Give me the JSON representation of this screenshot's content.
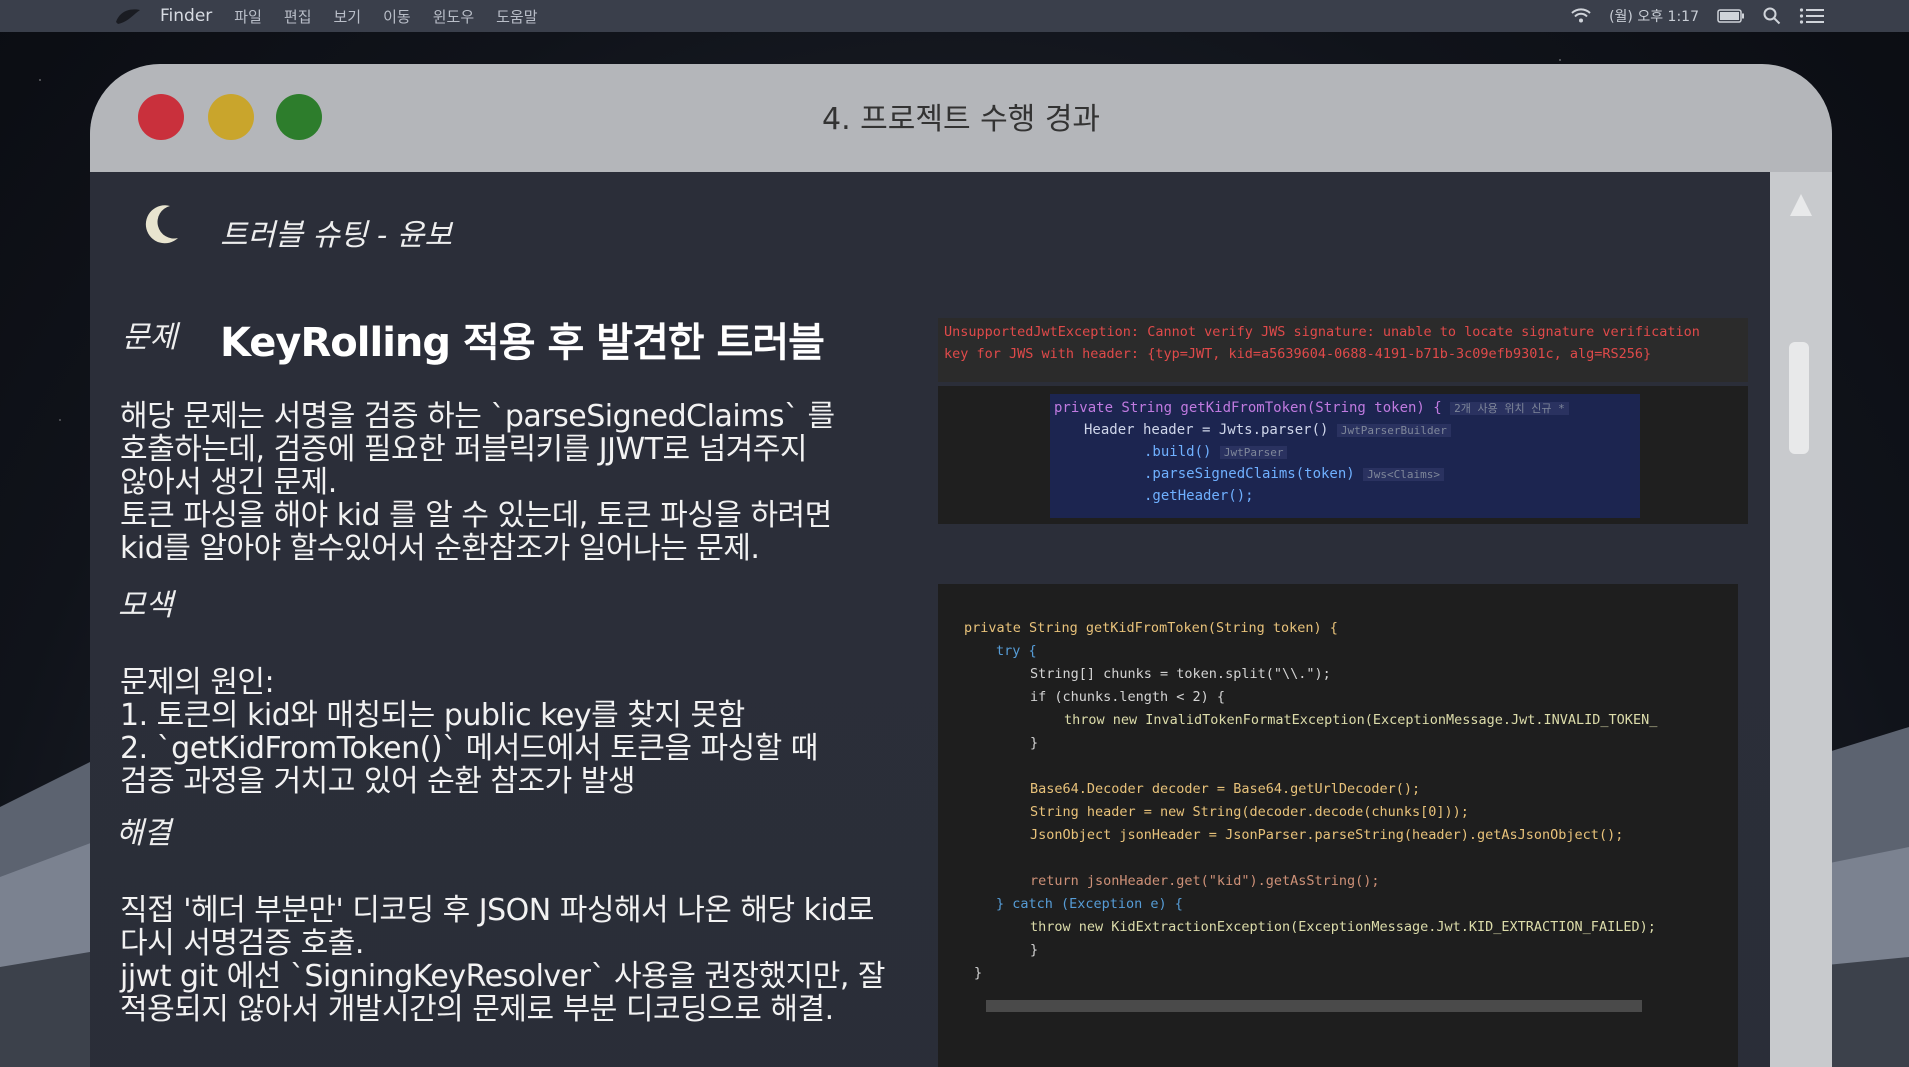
{
  "menubar": {
    "app": "Finder",
    "items": [
      "파일",
      "편집",
      "보기",
      "이동",
      "윈도우",
      "도움말"
    ],
    "clock": "(월) 오후 1:17",
    "icons": [
      "wifi-icon",
      "battery-icon",
      "search-icon",
      "list-icon"
    ]
  },
  "window": {
    "title": "4. 프로젝트 수행 경과",
    "colors": {
      "close": "#c9303c",
      "minimize": "#c9a52c",
      "zoom": "#2d7d2c"
    }
  },
  "slide": {
    "section": "트러블 슈팅 - 윤보",
    "labels": {
      "problem": "문제",
      "search": "모색",
      "solve": "해결"
    },
    "heading": "KeyRolling 적용 후 발견한 트러블",
    "problem_lines": [
      "해당 문제는 서명을 검증 하는 `parseSignedClaims` 를",
      "호출하는데, 검증에 필요한 퍼블릭키를 JJWT로 넘겨주지",
      "않아서 생긴 문제.",
      "토큰 파싱을 해야 kid 를 알 수 있는데, 토큰 파싱을 하려면",
      "kid를 알아야 할수있어서 순환참조가 일어나는 문제."
    ],
    "search_lines": [
      "문제의 원인:",
      "1. 토큰의 kid와 매칭되는 public key를 찾지 못함",
      "2. `getKidFromToken()` 메서드에서 토큰을 파싱할 때",
      "검증 과정을 거치고 있어 순환 참조가 발생"
    ],
    "solve_lines": [
      "직접 '헤더 부분만' 디코딩 후 JSON 파싱해서 나온 해당 kid로",
      "다시 서명검증 호출.",
      "jjwt git 에선 `SigningKeyResolver` 사용을 권장했지만, 잘",
      "적용되지 않아서 개발시간의 문제로 부분 디코딩으로 해결."
    ]
  },
  "error_log": [
    "UnsupportedJwtException: Cannot verify JWS signature: unable to locate signature verification",
    "key for JWS with header: {typ=JWT, kid=a5639604-0688-4191-b71b-3c09efb9301c, alg=RS256}"
  ],
  "code_before": {
    "lines": [
      "private String getKidFromToken(String token) {",
      "Header header = Jwts.parser()",
      ".build()",
      ".parseSignedClaims(token)",
      ".getHeader();"
    ],
    "hints": [
      "2개 사용 위치   신규 *",
      "JwtParserBuilder",
      "JwtParser",
      "Jws<Claims>"
    ]
  },
  "code_after": {
    "lines": [
      "private String getKidFromToken(String token) {",
      "try {",
      "String[] chunks = token.split(\"\\\\.\");",
      "if (chunks.length < 2) {",
      "throw new InvalidTokenFormatException(ExceptionMessage.Jwt.INVALID_TOKEN_",
      "}",
      "Base64.Decoder decoder = Base64.getUrlDecoder();",
      "String header = new String(decoder.decode(chunks[0]));",
      "JsonObject jsonHeader = JsonParser.parseString(header).getAsJsonObject();",
      "return jsonHeader.get(\"kid\").getAsString();",
      "} catch (Exception e) {",
      "throw new KidExtractionException(ExceptionMessage.Jwt.KID_EXTRACTION_FAILED);",
      "}",
      "}"
    ]
  }
}
